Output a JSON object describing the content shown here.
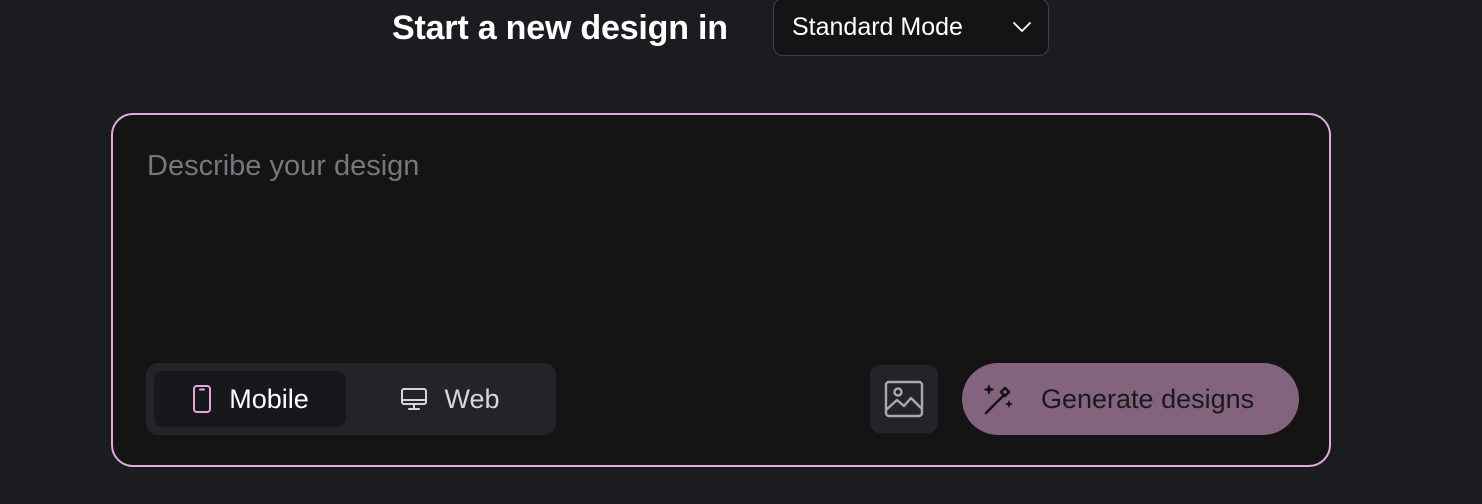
{
  "header": {
    "title": "Start a new design in",
    "mode_select": {
      "selected": "Standard Mode",
      "icon": "chevron-down-icon"
    }
  },
  "prompt": {
    "placeholder": "Describe your design",
    "value": ""
  },
  "device_toggle": {
    "options": [
      {
        "label": "Mobile",
        "icon": "mobile-phone-icon",
        "active": true
      },
      {
        "label": "Web",
        "icon": "desktop-monitor-icon",
        "active": false
      }
    ]
  },
  "image_button": {
    "icon": "image-icon"
  },
  "generate_button": {
    "label": "Generate designs",
    "icon": "magic-wand-icon"
  },
  "colors": {
    "background": "#1b1c20",
    "card_border": "#e2a9dd",
    "generate_bg": "#83637e",
    "mobile_icon": "#e8a6df"
  }
}
